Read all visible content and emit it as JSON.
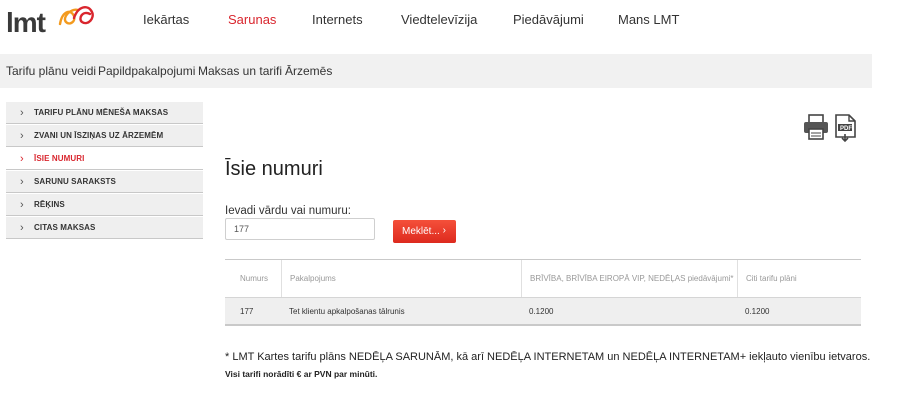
{
  "brand": {
    "logo_text": "lmt",
    "accent_color": "#d9262e"
  },
  "topnav": {
    "items": [
      {
        "label": "Iekārtas"
      },
      {
        "label": "Sarunas",
        "active": true
      },
      {
        "label": "Internets"
      },
      {
        "label": "Viedtelevīzija"
      },
      {
        "label": "Piedāvājumi"
      },
      {
        "label": "Mans LMT"
      }
    ]
  },
  "subnav": {
    "items": [
      {
        "label": "Tarifu plānu veidi"
      },
      {
        "label": "Papildpakalpojumi"
      },
      {
        "label": "Maksas un tarifi"
      },
      {
        "label": "Ārzemēs"
      }
    ]
  },
  "sidebar": {
    "items": [
      {
        "label": "TARIFU PLĀNU MĒNEŠA MAKSAS"
      },
      {
        "label": "ZVANI UN ĪSZIŅAS UZ ĀRZEMĒM"
      },
      {
        "label": "ĪSIE NUMURI",
        "active": true
      },
      {
        "label": "SARUNU SARAKSTS"
      },
      {
        "label": "RĒĶINS"
      },
      {
        "label": "CITAS MAKSAS"
      }
    ]
  },
  "tools": {
    "print_icon": "print-icon",
    "pdf_icon": "pdf-icon"
  },
  "main": {
    "title": "Īsie numuri",
    "search_label": "Ievadi vārdu vai numuru:",
    "search_value": "177",
    "search_button": "Meklēt...",
    "table": {
      "headers": [
        "Numurs",
        "Pakalpojums",
        "BRĪVĪBA, BRĪVĪBA EIROPĀ VIP, NEDĒĻAS piedāvājumi*",
        "Citi tarifu plāni"
      ],
      "rows": [
        [
          "177",
          "Tet klientu apkalpošanas tālrunis",
          "0.1200",
          "0.1200"
        ]
      ]
    },
    "footnote": "* LMT Kartes tarifu plāns NEDĒĻA SARUNĀM, kā arī NEDĒĻA INTERNETAM un NEDĒĻA INTERNETAM+ iekļauto vienību ietvaros.",
    "footnote_bold": "Visi tarifi norādīti € ar PVN par minūti."
  }
}
